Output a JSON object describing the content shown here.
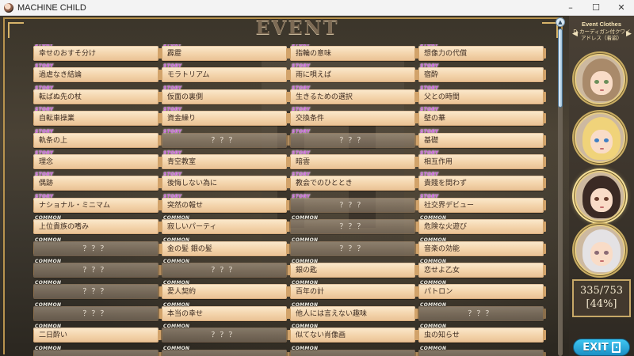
{
  "window": {
    "title": "MACHINE CHILD",
    "icon": "app-portrait-icon",
    "minimize_glyph": "–",
    "maximize_glyph": "☐",
    "close_glyph": "✕"
  },
  "screen": {
    "title": "EVENT"
  },
  "tags": {
    "story": "STORY",
    "common": "COMMON"
  },
  "events": {
    "columns": [
      [
        {
          "tag": "story",
          "label": "幸せのおすそ分け"
        },
        {
          "tag": "story",
          "label": "過虐なき結論"
        },
        {
          "tag": "story",
          "label": "転ばぬ先の杖"
        },
        {
          "tag": "story",
          "label": "自転車操業"
        },
        {
          "tag": "story",
          "label": "軌条の上"
        },
        {
          "tag": "story",
          "label": "理念"
        },
        {
          "tag": "story",
          "label": "偶跡"
        },
        {
          "tag": "story",
          "label": "ナショナル・ミニマム"
        },
        {
          "tag": "common",
          "label": "上位貴族の嗜み"
        },
        {
          "tag": "common",
          "label": "？？？",
          "locked": true
        },
        {
          "tag": "common",
          "label": "？？？",
          "locked": true
        },
        {
          "tag": "common",
          "label": "？？？",
          "locked": true
        },
        {
          "tag": "common",
          "label": "？？？",
          "locked": true
        },
        {
          "tag": "common",
          "label": "二日酔い"
        },
        {
          "tag": "common",
          "label": "",
          "locked": true
        }
      ],
      [
        {
          "tag": "story",
          "label": "霹靂"
        },
        {
          "tag": "story",
          "label": "モラトリアム"
        },
        {
          "tag": "story",
          "label": "仮面の裏側"
        },
        {
          "tag": "story",
          "label": "資金繰り"
        },
        {
          "tag": "story",
          "label": "？？？",
          "locked": true
        },
        {
          "tag": "story",
          "label": "青空教室"
        },
        {
          "tag": "story",
          "label": "後悔しない為に"
        },
        {
          "tag": "story",
          "label": "突然の報せ"
        },
        {
          "tag": "common",
          "label": "寂しいパーティ"
        },
        {
          "tag": "common",
          "label": "金の髪 銀の髪"
        },
        {
          "tag": "common",
          "label": "？？？",
          "locked": true
        },
        {
          "tag": "common",
          "label": "愛人契約"
        },
        {
          "tag": "common",
          "label": "本当の幸せ"
        },
        {
          "tag": "common",
          "label": "？？？",
          "locked": true
        },
        {
          "tag": "common",
          "label": "",
          "locked": true
        }
      ],
      [
        {
          "tag": "story",
          "label": "指輪の意味"
        },
        {
          "tag": "story",
          "label": "雨に唄えば"
        },
        {
          "tag": "story",
          "label": "生きるための選択"
        },
        {
          "tag": "story",
          "label": "交換条件"
        },
        {
          "tag": "story",
          "label": "？？？",
          "locked": true
        },
        {
          "tag": "story",
          "label": "暗雲"
        },
        {
          "tag": "story",
          "label": "教会でのひととき"
        },
        {
          "tag": "story",
          "label": "？？？",
          "locked": true
        },
        {
          "tag": "common",
          "label": "？？？",
          "locked": true
        },
        {
          "tag": "common",
          "label": "？？？",
          "locked": true
        },
        {
          "tag": "common",
          "label": "銀の匙"
        },
        {
          "tag": "common",
          "label": "百年の計"
        },
        {
          "tag": "common",
          "label": "他人には言えない趣味"
        },
        {
          "tag": "common",
          "label": "似てない肖像画"
        },
        {
          "tag": "common",
          "label": "",
          "locked": true
        }
      ],
      [
        {
          "tag": "story",
          "label": "想像力の代償"
        },
        {
          "tag": "story",
          "label": "宿酔"
        },
        {
          "tag": "story",
          "label": "父との時間"
        },
        {
          "tag": "story",
          "label": "壁の華"
        },
        {
          "tag": "story",
          "label": "基礎"
        },
        {
          "tag": "story",
          "label": "相互作用"
        },
        {
          "tag": "story",
          "label": "貴賤を問わず"
        },
        {
          "tag": "story",
          "label": "社交界デビュー"
        },
        {
          "tag": "common",
          "label": "危険な火遊び"
        },
        {
          "tag": "common",
          "label": "音楽の効能"
        },
        {
          "tag": "common",
          "label": "恋せよ乙女"
        },
        {
          "tag": "common",
          "label": "パトロン"
        },
        {
          "tag": "common",
          "label": "？？？",
          "locked": true
        },
        {
          "tag": "common",
          "label": "虫の知らせ"
        },
        {
          "tag": "common",
          "label": "",
          "locked": true
        }
      ]
    ]
  },
  "sidebar": {
    "heading": "Event Clothes",
    "outfit_name": "Ｄ.カーディガン付クワイアドレス（着崩）",
    "prev_glyph": "◀",
    "next_glyph": "▶",
    "portraits": [
      {
        "name": "portrait-brown-hair",
        "hair": "#a98a6a",
        "eye": "#6b8f5a",
        "selected": false
      },
      {
        "name": "portrait-blonde-hair",
        "hair": "#f0d37a",
        "eye": "#3f7fc4",
        "selected": false
      },
      {
        "name": "portrait-dark-hair",
        "hair": "#3b2a24",
        "eye": "#6a3f2f",
        "selected": true
      },
      {
        "name": "portrait-silver-hair",
        "hair": "#e4e2e4",
        "eye": "#8a6a74",
        "selected": false
      }
    ],
    "progress": {
      "collected": 335,
      "total": 753,
      "count_text": "335/753",
      "percent_text": "[44%]"
    },
    "exit_label": "EXIT"
  },
  "colors": {
    "story_tag": "#c75bd9",
    "common_tag": "#f4f0e4",
    "plate": "#f3d3aa",
    "frame_gold": "#b8934e",
    "exit_blue": "#2aa9dd"
  }
}
